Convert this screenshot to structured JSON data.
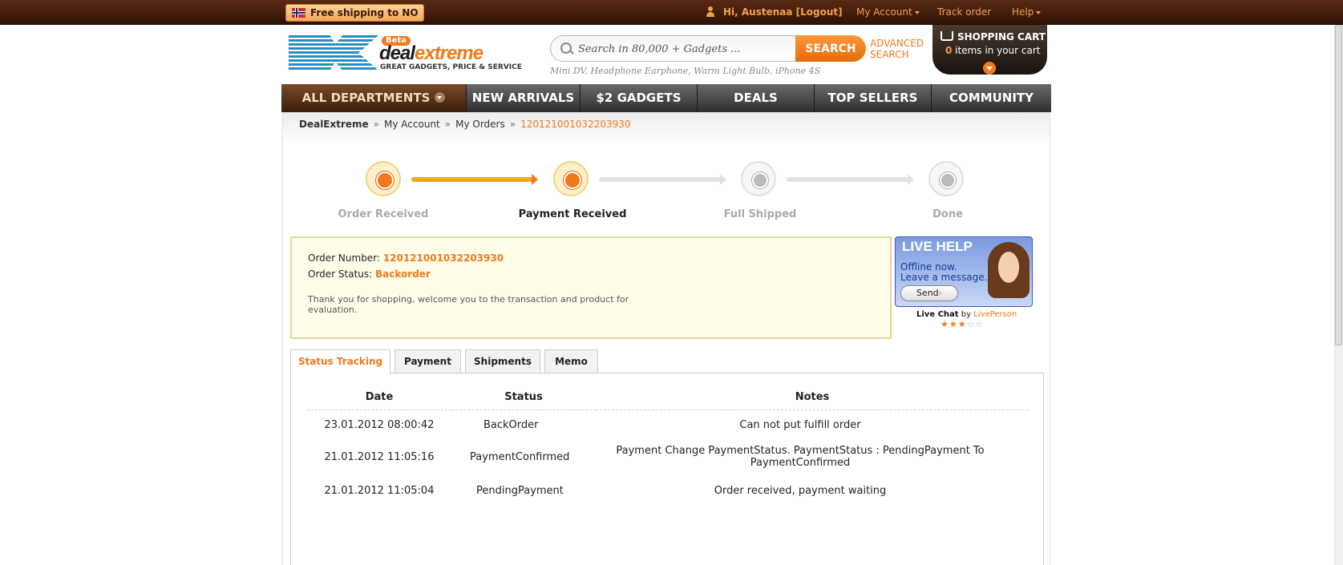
{
  "topbar": {
    "free_shipping": "Free shipping to NO",
    "greeting": "Hi, Austenaa [Logout]",
    "my_account": "My Account",
    "track_order": "Track order",
    "help": "Help"
  },
  "logo": {
    "badge": "Beta",
    "brand_a": "deal",
    "brand_b": "extreme",
    "tagline": "GREAT GADGETS, PRICE & SERVICE"
  },
  "search": {
    "placeholder": "Search in 80,000 + Gadgets ...",
    "button": "SEARCH",
    "advanced_1": "ADVANCED",
    "advanced_2": "SEARCH",
    "suggestions": "Mini DV,  Headphone Earphone,  Warm Light Bulb,  iPhone 4S"
  },
  "cart": {
    "title": "SHOPPING CART",
    "count": "0",
    "count_suffix": " items in your cart"
  },
  "nav": {
    "items": [
      "ALL DEPARTMENTS",
      "NEW ARRIVALS",
      "$2 GADGETS",
      "DEALS",
      "TOP SELLERS",
      "COMMUNITY"
    ]
  },
  "breadcrumb": {
    "home": "DealExtreme",
    "account": "My Account",
    "orders": "My Orders",
    "current": "120121001032203930",
    "sep": "»"
  },
  "progress": {
    "steps": [
      {
        "label": "Order Received",
        "state": "done"
      },
      {
        "label": "Payment Received",
        "state": "current"
      },
      {
        "label": "Full Shipped",
        "state": "todo"
      },
      {
        "label": "Done",
        "state": "todo"
      }
    ]
  },
  "order": {
    "number_label": "Order Number:",
    "number": "120121001032203930",
    "status_label": "Order Status:",
    "status": "Backorder",
    "thanks": "Thank you for shopping, welcome you to the transaction and product for evaluation."
  },
  "livehelp": {
    "title": "LIVE HELP",
    "line1": "Offline now.",
    "line2": "Leave a message.",
    "send": "Send",
    "send_arrow": "›",
    "chat_label": "Live Chat",
    "by": "by",
    "provider": "LivePerson",
    "rating": 2.5,
    "rating_max": 5
  },
  "tabs": [
    "Status Tracking",
    "Payment",
    "Shipments",
    "Memo"
  ],
  "tracking": {
    "headers": [
      "Date",
      "Status",
      "Notes"
    ],
    "rows": [
      {
        "date": "23.01.2012 08:00:42",
        "status": "BackOrder",
        "notes": "Can not put fulfill order"
      },
      {
        "date": "21.01.2012 11:05:16",
        "status": "PaymentConfirmed",
        "notes": "Payment Change PaymentStatus. PaymentStatus : PendingPayment To PaymentConfirmed"
      },
      {
        "date": "21.01.2012 11:05:04",
        "status": "PendingPayment",
        "notes": "Order received, payment waiting"
      }
    ]
  },
  "colors": {
    "accent": "#f07a1a",
    "topbar": "#3e1a08",
    "nav": "#3a3a3a"
  }
}
